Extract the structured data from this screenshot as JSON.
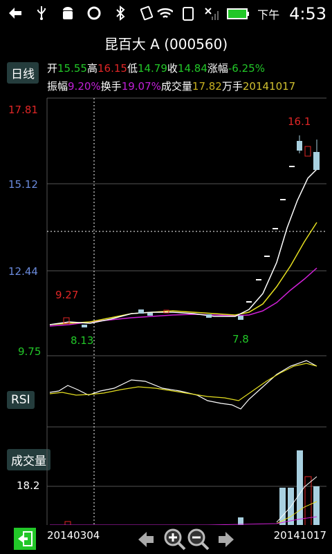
{
  "status_bar": {
    "ampm": "下午",
    "time": "4:53",
    "icons": [
      "back-icon",
      "usb-icon",
      "android-icon",
      "sync-icon",
      "bluetooth-icon",
      "vibrate-icon",
      "wifi-icon",
      "sim-icon",
      "signal-icon",
      "battery-icon"
    ]
  },
  "header": {
    "title": "昆百大 A (000560)"
  },
  "tabs": {
    "daily": "日线",
    "rsi": "RSI",
    "volume": "成交量"
  },
  "quote": {
    "open_label": "开",
    "open": "15.55",
    "high_label": "高",
    "high": "16.15",
    "low_label": "低",
    "low": "14.79",
    "close_label": "收",
    "close": "14.84",
    "change_label": "涨幅",
    "change": "-6.25%",
    "amplitude_label": "振幅",
    "amplitude": "9.20%",
    "turnover_label": "换手",
    "turnover": "19.07%",
    "volume_label": "成交量",
    "volume": "17.82",
    "volume_unit": "万手",
    "date": "20141017"
  },
  "axis": {
    "price_ticks": [
      "17.81",
      "15.12",
      "12.44",
      "9.75"
    ],
    "volume_tick": "18.2",
    "start_date": "20140304",
    "end_date": "20141017"
  },
  "annotations": {
    "peak": "16.1",
    "high_left": "9.27",
    "low_left": "8.13",
    "low_mid": "7.8"
  },
  "colors": {
    "up": "#e02626",
    "down": "#a8d0e0",
    "ma_white": "#ffffff",
    "ma_yellow": "#e6e020",
    "ma_purple": "#d020d8",
    "grid": "#555555"
  },
  "toolbar_icons": [
    "exit-icon",
    "arrow-left-icon",
    "zoom-in-icon",
    "zoom-out-icon",
    "arrow-right-icon"
  ]
}
